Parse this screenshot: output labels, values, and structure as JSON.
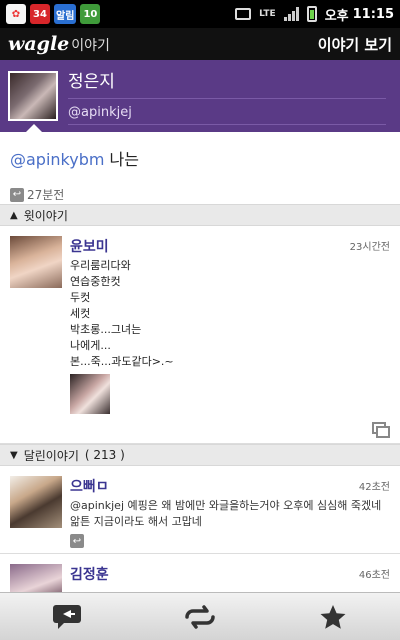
{
  "statusbar": {
    "notif_34": "34",
    "notif_mail": "알림",
    "notif_10": "10",
    "network": "LTE",
    "ampm": "오후",
    "time": "11:15"
  },
  "appbar": {
    "logo": "wagle",
    "logo_sub": "이야기",
    "title": "이야기 보기"
  },
  "profile": {
    "name": "정은지",
    "handle": "@apinkjej"
  },
  "message": {
    "mention": "@apinkybm",
    "text": " 나는",
    "time": "27분전"
  },
  "upper_section": {
    "label": "윗이야기"
  },
  "upper_post": {
    "author": "윤보미",
    "time": "23시간전",
    "lines": [
      "우리룸리다와",
      "연습중한컷",
      "두컷",
      "세컷",
      "박초롱...그녀는",
      "나에게...",
      "본...죽...과도같다>.~"
    ]
  },
  "replies_section": {
    "label": "달린이야기",
    "count": "( 213 )"
  },
  "replies": [
    {
      "author": "으뻐ㅁ",
      "time": "42초전",
      "text": "@apinkjej 예핑은 왜 밤에만 와글을하는거야 오후에 심심해 죽겠네 앎튼 지금이라도 해서 고맙네"
    },
    {
      "author": "김정훈",
      "time": "46초전",
      "text": "..."
    }
  ],
  "toolbar": {
    "reply_icon": "reply-icon",
    "rewagle_icon": "rewagle-icon",
    "favorite_icon": "star-icon"
  }
}
